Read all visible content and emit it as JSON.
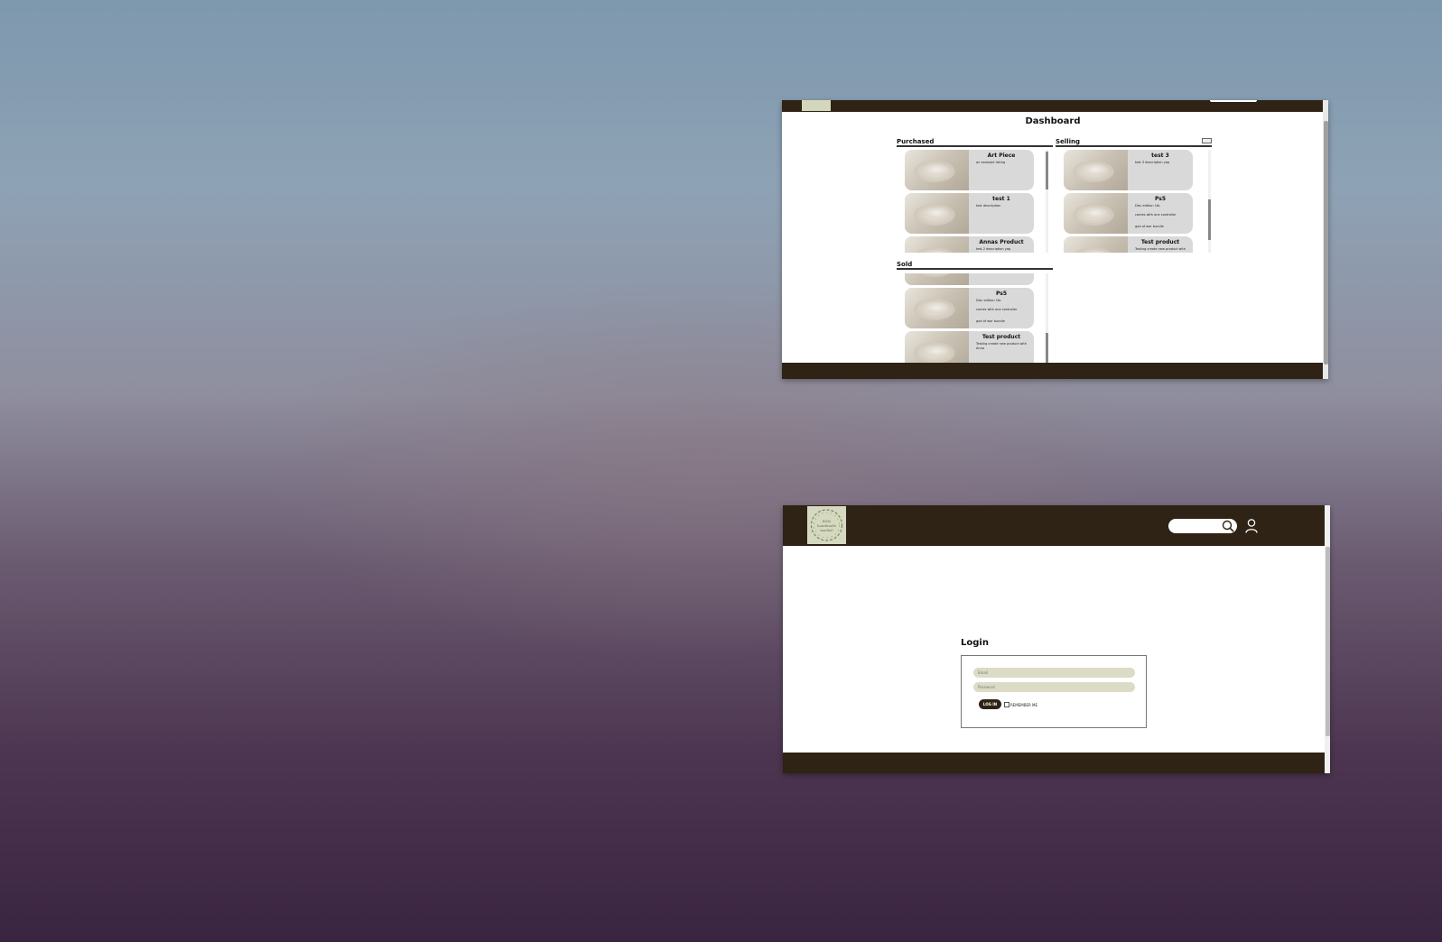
{
  "dashboard": {
    "title": "Dashboard",
    "sections": {
      "purchased": {
        "label": "Purchased",
        "items": [
          {
            "title": "Art Piece",
            "desc": [
              "an example listing"
            ]
          },
          {
            "title": "test 1",
            "desc": [
              "test description"
            ]
          },
          {
            "title": "Annas Product",
            "desc": [
              "test 2 description yap"
            ]
          }
        ]
      },
      "selling": {
        "label": "Selling",
        "items": [
          {
            "title": "test 3",
            "desc": [
              "test 3 description yap"
            ]
          },
          {
            "title": "Ps5",
            "desc": [
              "Disc edition 1tb",
              "comes with one controller",
              "god of war bundle"
            ]
          },
          {
            "title": "Test product",
            "desc": [
              "Testing create new product with"
            ]
          }
        ]
      },
      "sold": {
        "label": "Sold",
        "items": [
          {
            "title": "Ps5",
            "desc": [
              "Disc edition 1tb",
              "comes with one controller",
              "god of war bundle"
            ]
          },
          {
            "title": "Test product",
            "desc": [
              "Testing create new product with",
              "Anna"
            ]
          }
        ]
      }
    }
  },
  "login_page": {
    "logo_text": [
      "little",
      "handmade",
      "market"
    ],
    "title": "Login",
    "email_placeholder": "Email",
    "password_placeholder": "Password",
    "login_button": "LOG IN",
    "remember_label": "REMEMBER ME"
  },
  "colors": {
    "header_bg": "#2e2314",
    "card_bg": "#d9d9d9",
    "logo_bg": "#d5d9bf",
    "input_bg": "#dcdcc6"
  }
}
